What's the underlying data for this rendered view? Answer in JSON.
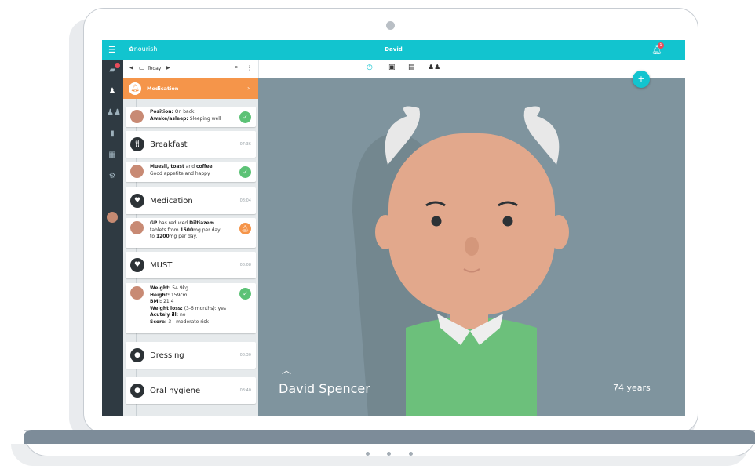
{
  "app": {
    "brand": "nourish",
    "window_title": "David",
    "notification_count": "1"
  },
  "toolbar": {
    "date_label": "Today"
  },
  "feed": {
    "alert_label": "Medication",
    "events": [
      {
        "label": "Breakfast",
        "time": "07:36",
        "icon": "fork-knife-icon"
      },
      {
        "label": "Medication",
        "time": "08:04",
        "icon": "heart-icon"
      },
      {
        "label": "MUST",
        "time": "08:08",
        "icon": "heart-icon"
      },
      {
        "label": "Dressing",
        "time": "08:30",
        "icon": "person-icon"
      },
      {
        "label": "Oral hygiene",
        "time": "08:40",
        "icon": "person-icon"
      }
    ],
    "notes": {
      "position": {
        "l1_bold": "Position:",
        "l1": " On back",
        "l2_bold": "Awake/asleep:",
        "l2": " Sleeping well"
      },
      "breakfast": {
        "a": "Muesli, toast",
        "b": " and ",
        "c": "coffee",
        "d": ".",
        "line2": "Good appetite and happy."
      },
      "medication": {
        "a": "GP",
        "b": " has reduced ",
        "c": "Diltiazem",
        "d": "tablets from ",
        "e": "1500",
        "f": "mg per day",
        "g": "to ",
        "h": "1200",
        "i": "mg per day."
      },
      "must": {
        "weight_label": "Weight:",
        "weight": " 54.9kg",
        "height_label": "Height:",
        "height": " 159cm",
        "bmi_label": "BMI:",
        "bmi": " 21.4",
        "loss_label": "Weight loss:",
        "loss": " (3-6 months): yes",
        "ill_label": "Acutely ill:",
        "ill": " no",
        "score_label": "Score:",
        "score": " 3 - moderate risk"
      }
    }
  },
  "resident": {
    "name": "David Spencer",
    "age": "74 years"
  },
  "colors": {
    "primary": "#12c4cf",
    "alert": "#f5954a",
    "ok": "#5cc276",
    "sidebar": "#2f3a42",
    "hero_bg": "#7f949e"
  }
}
